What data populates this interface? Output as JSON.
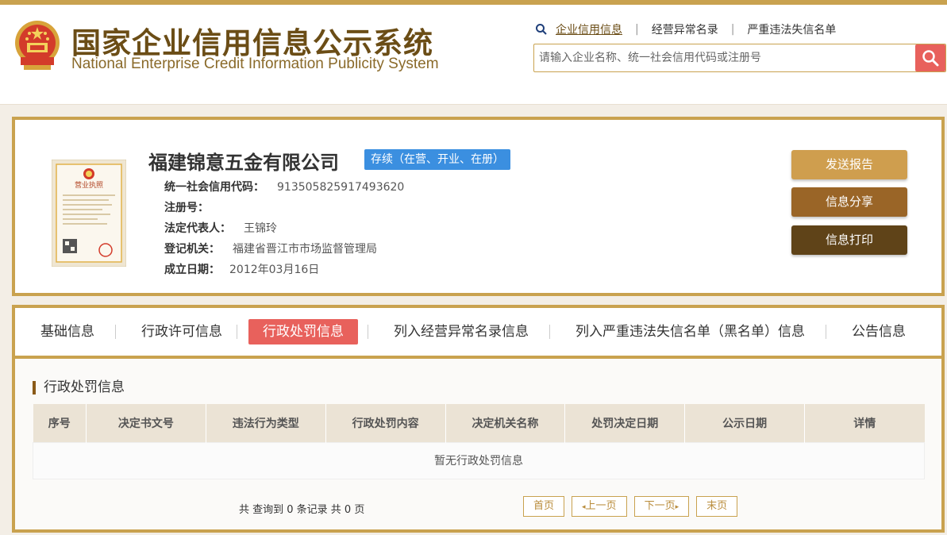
{
  "header": {
    "title_cn": "国家企业信用信息公示系统",
    "title_en": "National Enterprise Credit Information Publicity System",
    "nav": [
      {
        "label": "企业信用信息"
      },
      {
        "label": "经营异常名录"
      },
      {
        "label": "严重违法失信名单"
      }
    ],
    "search": {
      "placeholder": "请输入企业名称、统一社会信用代码或注册号",
      "value": ""
    }
  },
  "company": {
    "name": "福建锦意五金有限公司",
    "status": "存续（在营、开业、在册）",
    "fields": [
      {
        "key": "统一社会信用代码：",
        "value": "913505825917493620"
      },
      {
        "key": "注册号：",
        "value": ""
      },
      {
        "key": "法定代表人：",
        "value": "王锦玲"
      },
      {
        "key": "登记机关：",
        "value": "福建省晋江市市场监督管理局"
      },
      {
        "key": "成立日期：",
        "value": "2012年03月16日"
      }
    ],
    "license_title": "营业执照"
  },
  "actions": {
    "send_report": "发送报告",
    "share": "信息分享",
    "print": "信息打印"
  },
  "tabs": [
    {
      "label": "基础信息",
      "active": false
    },
    {
      "label": "行政许可信息",
      "active": false
    },
    {
      "label": "行政处罚信息",
      "active": true
    },
    {
      "label": "列入经营异常名录信息",
      "active": false
    },
    {
      "label": "列入严重违法失信名单（黑名单）信息",
      "active": false
    },
    {
      "label": "公告信息",
      "active": false
    }
  ],
  "section": {
    "title": "行政处罚信息",
    "columns": [
      "序号",
      "决定书文号",
      "违法行为类型",
      "行政处罚内容",
      "决定机关名称",
      "处罚决定日期",
      "公示日期",
      "详情"
    ],
    "empty_text": "暂无行政处罚信息"
  },
  "pagination": {
    "summary": "共 查询到 0 条记录 共 0 页",
    "first": "首页",
    "prev": "上一页",
    "next": "下一页",
    "last": "末页"
  },
  "colors": {
    "accent_gold": "#c9a24f",
    "active_tab": "#e8615c",
    "status_blue": "#3b8fe0"
  }
}
